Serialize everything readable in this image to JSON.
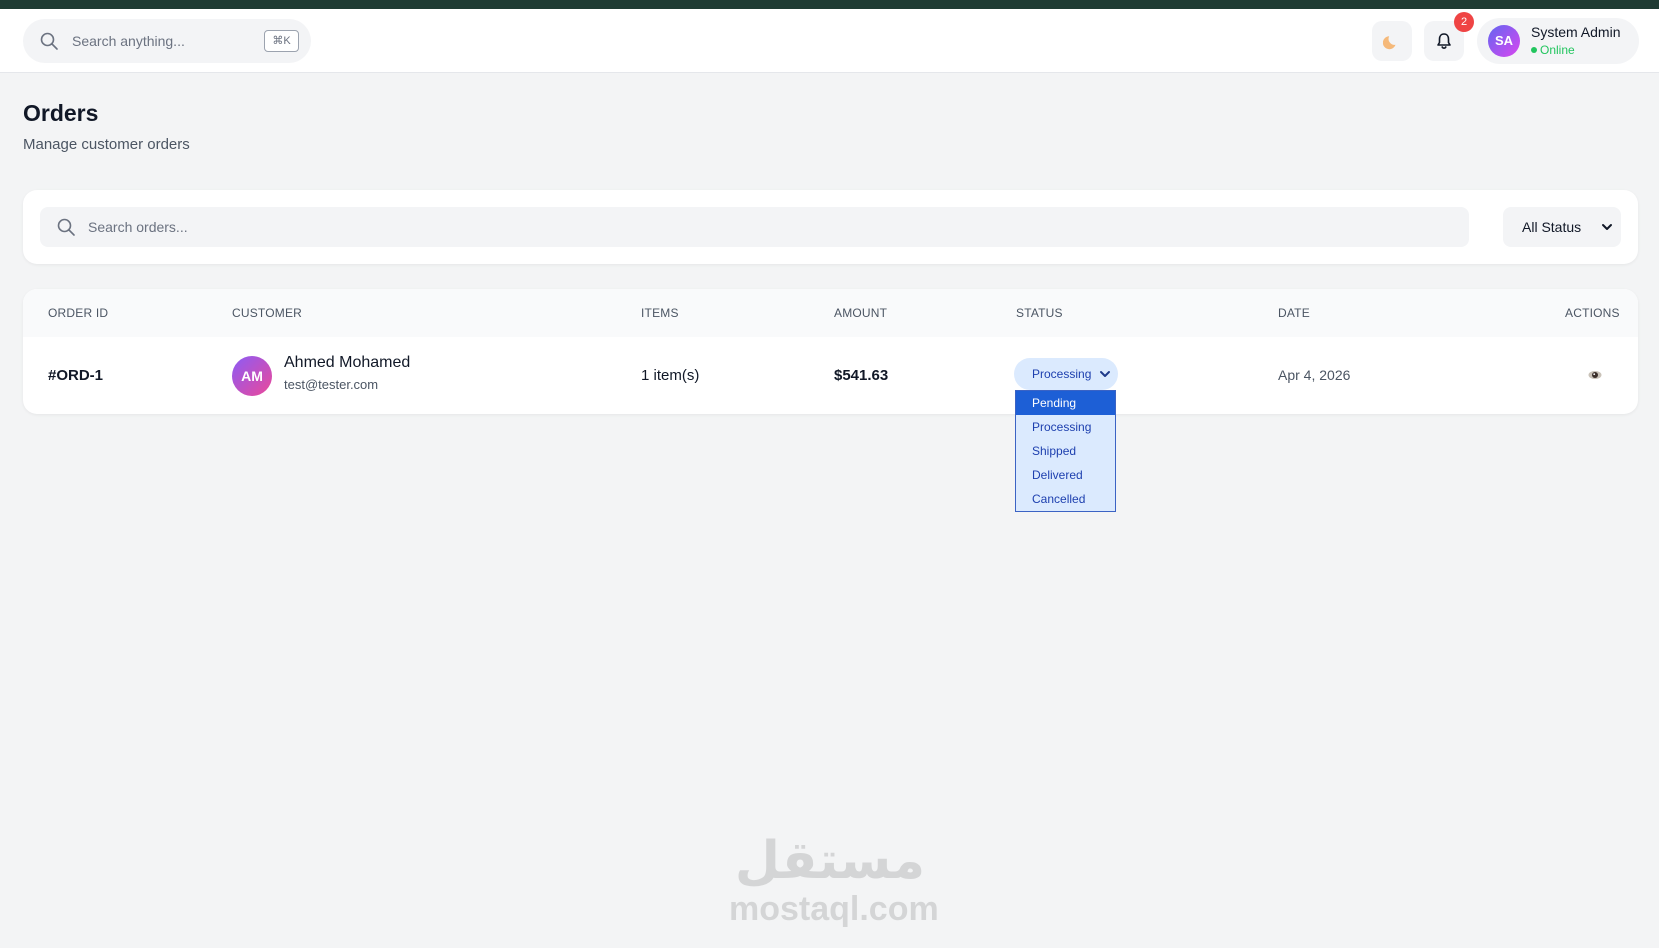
{
  "header": {
    "search_placeholder": "Search anything...",
    "search_shortcut": "⌘K",
    "notification_count": "2",
    "user": {
      "initials": "SA",
      "name": "System Admin",
      "status": "Online"
    }
  },
  "page": {
    "title": "Orders",
    "subtitle": "Manage customer orders"
  },
  "filters": {
    "search_placeholder": "Search orders...",
    "status_filter": "All Status"
  },
  "table": {
    "columns": [
      "ORDER ID",
      "CUSTOMER",
      "ITEMS",
      "AMOUNT",
      "STATUS",
      "DATE",
      "ACTIONS"
    ],
    "rows": [
      {
        "order_id": "#ORD-1",
        "customer_initials": "AM",
        "customer_name": "Ahmed Mohamed",
        "customer_email": "test@tester.com",
        "items": "1 item(s)",
        "amount": "$541.63",
        "status": "Processing",
        "date": "Apr 4, 2026"
      }
    ]
  },
  "status_dropdown": {
    "options": [
      "Pending",
      "Processing",
      "Shipped",
      "Delivered",
      "Cancelled"
    ],
    "highlighted": "Pending"
  },
  "watermark": {
    "arabic": "مستقل",
    "latin": "mostaql.com"
  },
  "colors": {
    "accent": "#1d5fd6",
    "online": "#22c55e",
    "badge": "#ef4444",
    "status_bg": "#dbeafe",
    "status_text": "#1e40af"
  }
}
